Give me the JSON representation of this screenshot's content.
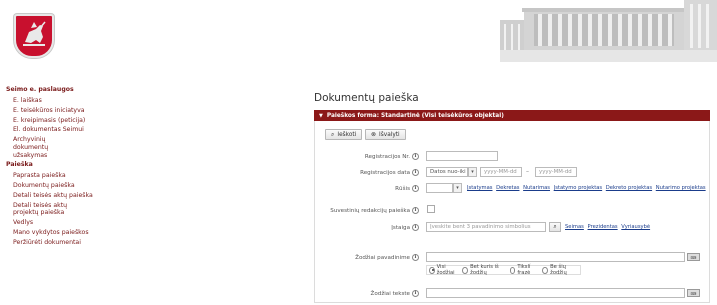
{
  "header": {
    "logo_icon": "coat-of-arms-icon",
    "building_image": "seimas-building-image"
  },
  "sidebar": {
    "section1_title": "Seimo e. paslaugos",
    "section1_items": [
      "E. laiškas",
      "E. teisėkūros iniciatyva",
      "E. kreipimasis (peticija)",
      "El. dokumentas Seimui",
      "Archyvinių dokumentų užsakymas"
    ],
    "section2_title": "Paieška",
    "section2_items": [
      "Paprasta paieška",
      "Dokumentų paieška",
      "Detali teisės aktų paieška",
      "Detali teisės aktų projektų paieška",
      "Vedlys",
      "Mano vykdytos paieškos",
      "Peržiūrėti dokumentai"
    ]
  },
  "main": {
    "title": "Dokumentų paieška",
    "panel_title": "Paieškos forma: Standartinė (Visi teisėkūros objektai)",
    "search_button": "Ieškoti",
    "clear_button": "Išvalyti",
    "fields": {
      "reg_no_label": "Registracijos Nr.",
      "reg_date_label": "Registracijos data",
      "reg_date_select": "Datos nuo-iki",
      "date_from_placeholder": "yyyy-MM-dd",
      "date_to_placeholder": "yyyy-MM-dd",
      "date_dash": "–",
      "type_label": "Rūšis",
      "type_links": [
        "Įstatymas",
        "Dekretas",
        "Nutarimas",
        "Įstatymo projektas",
        "Dekreto projektas",
        "Nutarimo projektas"
      ],
      "consolidated_label": "Suvestinių redakcijų paieška",
      "institution_label": "Įstaiga",
      "institution_placeholder": "Įveskite bent 3 pavadinimo simbolius",
      "institution_links": [
        "Seimas",
        "Prezidentas",
        "Vyriausybė"
      ],
      "title_words_label": "Žodžiai pavadinime",
      "text_words_label": "Žodžiai tekste",
      "radios": [
        "Visi žodžiai",
        "Bet kuris iš žodžių",
        "Tikslí frazė",
        "Be šių žodžių"
      ]
    }
  }
}
